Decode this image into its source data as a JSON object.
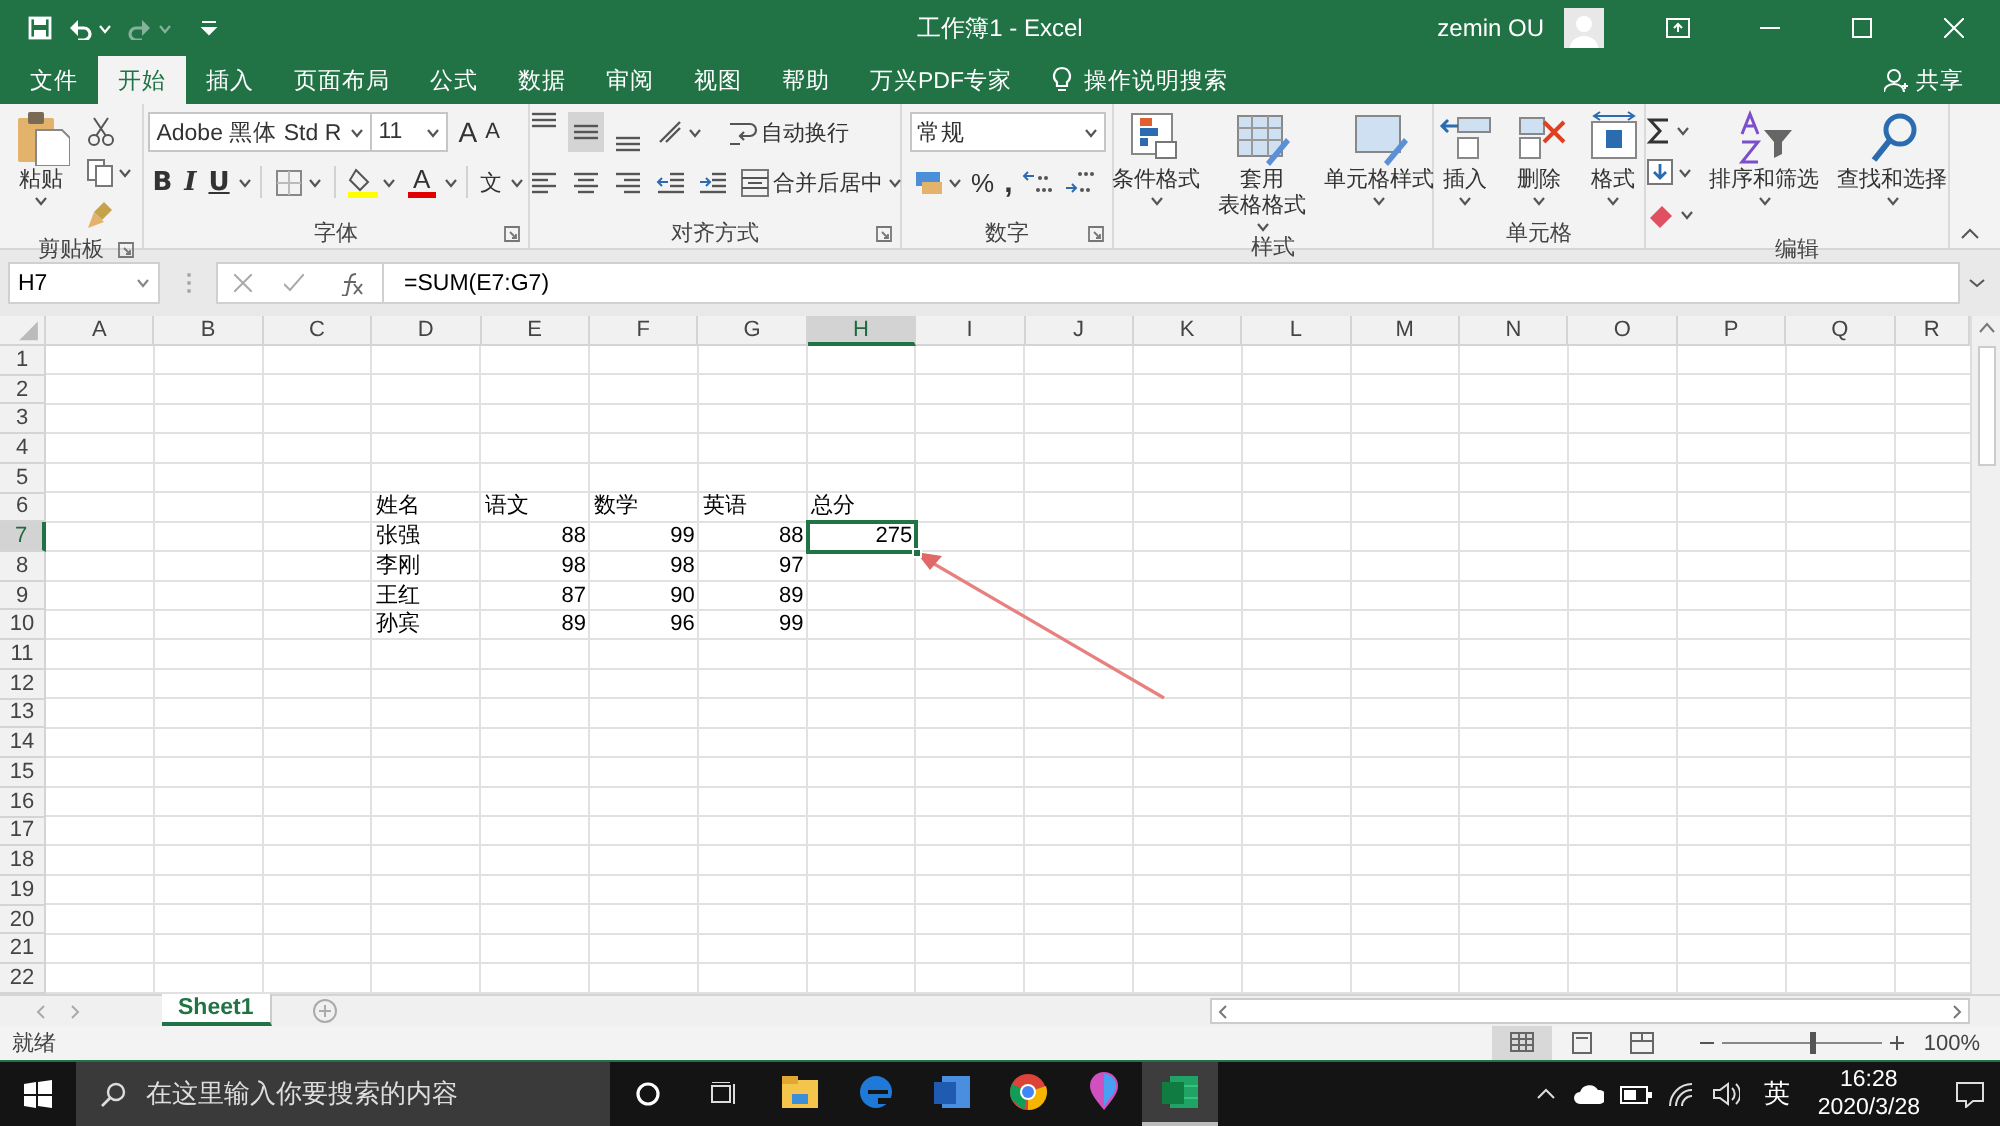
{
  "window": {
    "title": "工作簿1 - Excel",
    "user": "zemin OU"
  },
  "ribbon_tabs": [
    {
      "label": "文件",
      "selected": false
    },
    {
      "label": "开始",
      "selected": true
    },
    {
      "label": "插入",
      "selected": false
    },
    {
      "label": "页面布局",
      "selected": false
    },
    {
      "label": "公式",
      "selected": false
    },
    {
      "label": "数据",
      "selected": false
    },
    {
      "label": "审阅",
      "selected": false
    },
    {
      "label": "视图",
      "selected": false
    },
    {
      "label": "帮助",
      "selected": false
    },
    {
      "label": "万兴PDF专家",
      "selected": false
    }
  ],
  "tell_me": "操作说明搜索",
  "share": "共享",
  "ribbon": {
    "clipboard": {
      "label": "剪贴板",
      "paste": "粘贴"
    },
    "font": {
      "label": "字体",
      "font_name": "Adobe 黑体 Std R",
      "font_size": "11",
      "grow": "A",
      "shrink": "A",
      "bold": "B",
      "italic": "I",
      "underline": "U",
      "font_color": "A",
      "phonetic": "文"
    },
    "alignment": {
      "label": "对齐方式",
      "wrap": "自动换行",
      "merge": "合并后居中"
    },
    "number": {
      "label": "数字",
      "format": "常规",
      "percent": "%",
      "comma": ","
    },
    "styles": {
      "label": "样式",
      "buttons": [
        {
          "lines": [
            "条件格式"
          ]
        },
        {
          "lines": [
            "套用",
            "表格格式"
          ]
        },
        {
          "lines": [
            "单元格样式"
          ]
        }
      ]
    },
    "cells": {
      "label": "单元格",
      "buttons": [
        "插入",
        "删除",
        "格式"
      ]
    },
    "editing": {
      "label": "编辑",
      "buttons": [
        "排序和筛选",
        "查找和选择"
      ]
    }
  },
  "formula_bar": {
    "name_box": "H7",
    "formula": "=SUM(E7:G7)"
  },
  "columns": [
    {
      "label": "A",
      "selected": false
    },
    {
      "label": "B",
      "selected": false
    },
    {
      "label": "C",
      "selected": false
    },
    {
      "label": "D",
      "selected": false
    },
    {
      "label": "E",
      "selected": false
    },
    {
      "label": "F",
      "selected": false
    },
    {
      "label": "G",
      "selected": false
    },
    {
      "label": "H",
      "selected": true
    },
    {
      "label": "I",
      "selected": false
    },
    {
      "label": "J",
      "selected": false
    },
    {
      "label": "K",
      "selected": false
    },
    {
      "label": "L",
      "selected": false
    },
    {
      "label": "M",
      "selected": false
    },
    {
      "label": "N",
      "selected": false
    },
    {
      "label": "O",
      "selected": false
    },
    {
      "label": "P",
      "selected": false
    },
    {
      "label": "Q",
      "selected": false
    },
    {
      "label": "R",
      "selected": false
    }
  ],
  "rows": [
    {
      "label": "1",
      "selected": false
    },
    {
      "label": "2",
      "selected": false
    },
    {
      "label": "3",
      "selected": false
    },
    {
      "label": "4",
      "selected": false
    },
    {
      "label": "5",
      "selected": false
    },
    {
      "label": "6",
      "selected": false,
      "cells": [
        {
          "value": "姓名",
          "kind": "text",
          "selected": false
        },
        {
          "value": "语文",
          "kind": "text",
          "selected": false
        },
        {
          "value": "数学",
          "kind": "text",
          "selected": false
        },
        {
          "value": "英语",
          "kind": "text",
          "selected": false
        },
        {
          "value": "总分",
          "kind": "text",
          "selected": false
        }
      ]
    },
    {
      "label": "7",
      "selected": true,
      "cells": [
        {
          "value": "张强",
          "kind": "text",
          "selected": false
        },
        {
          "value": "88",
          "kind": "number",
          "selected": false
        },
        {
          "value": "99",
          "kind": "number",
          "selected": false
        },
        {
          "value": "88",
          "kind": "number",
          "selected": false
        },
        {
          "value": "275",
          "kind": "number",
          "selected": true
        }
      ]
    },
    {
      "label": "8",
      "selected": false,
      "cells": [
        {
          "value": "李刚",
          "kind": "text",
          "selected": false
        },
        {
          "value": "98",
          "kind": "number",
          "selected": false
        },
        {
          "value": "98",
          "kind": "number",
          "selected": false
        },
        {
          "value": "97",
          "kind": "number",
          "selected": false
        }
      ]
    },
    {
      "label": "9",
      "selected": false,
      "cells": [
        {
          "value": "王红",
          "kind": "text",
          "selected": false
        },
        {
          "value": "87",
          "kind": "number",
          "selected": false
        },
        {
          "value": "90",
          "kind": "number",
          "selected": false
        },
        {
          "value": "89",
          "kind": "number",
          "selected": false
        }
      ]
    },
    {
      "label": "10",
      "selected": false,
      "cells": [
        {
          "value": "孙宾",
          "kind": "text",
          "selected": false
        },
        {
          "value": "89",
          "kind": "number",
          "selected": false
        },
        {
          "value": "96",
          "kind": "number",
          "selected": false
        },
        {
          "value": "99",
          "kind": "number",
          "selected": false
        }
      ]
    },
    {
      "label": "11",
      "selected": false
    },
    {
      "label": "12",
      "selected": false
    },
    {
      "label": "13",
      "selected": false
    },
    {
      "label": "14",
      "selected": false
    },
    {
      "label": "15",
      "selected": false
    },
    {
      "label": "16",
      "selected": false
    },
    {
      "label": "17",
      "selected": false
    },
    {
      "label": "18",
      "selected": false
    },
    {
      "label": "19",
      "selected": false
    },
    {
      "label": "20",
      "selected": false
    },
    {
      "label": "21",
      "selected": false
    },
    {
      "label": "22",
      "selected": false
    }
  ],
  "sheets": [
    {
      "label": "Sheet1",
      "selected": true
    }
  ],
  "status": {
    "text": "就绪",
    "views": [
      {
        "kind": "normal",
        "selected": true
      },
      {
        "kind": "page_layout",
        "selected": false
      },
      {
        "kind": "page_break",
        "selected": false
      }
    ],
    "zoom": {
      "level": 0.55,
      "label": "100%"
    }
  },
  "taskbar": {
    "search_placeholder": "在这里输入你要搜索的内容",
    "apps": [
      {
        "kind": "explorer",
        "selected": false
      },
      {
        "kind": "edge",
        "selected": false
      },
      {
        "kind": "word",
        "selected": false
      },
      {
        "kind": "chrome",
        "selected": false
      },
      {
        "kind": "maps",
        "selected": false
      },
      {
        "kind": "excel",
        "selected": true
      }
    ],
    "ime": "英",
    "time": "16:28",
    "date": "2020/3/28"
  }
}
